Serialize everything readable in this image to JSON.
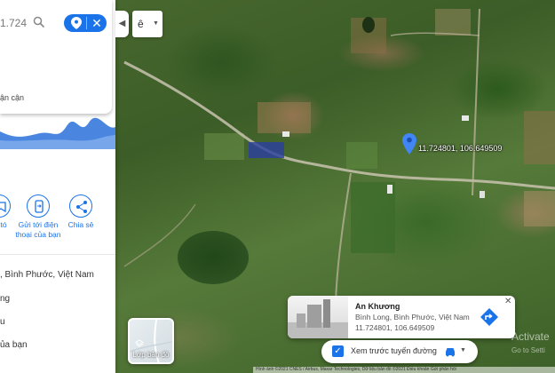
{
  "search": {
    "value": "1.72480'"
  },
  "panel": {
    "nearby_text": "ận cận",
    "actions": [
      {
        "label": "tó",
        "icon": "save-icon"
      },
      {
        "label": "Gửi tới điện thoại của bạn",
        "icon": "send-to-phone-icon"
      },
      {
        "label": "Chia sẻ",
        "icon": "share-icon"
      }
    ],
    "info_rows": [
      {
        "text": ", Bình Phước, Việt Nam",
        "icon": "location-icon"
      },
      {
        "text": "ng",
        "icon": "label-icon"
      },
      {
        "text": "u",
        "icon": "save-icon"
      },
      {
        "text": "ủa bạn",
        "icon": "phone-icon"
      }
    ]
  },
  "layer_control": {
    "glyph": "ê"
  },
  "layers_button": {
    "label": "Lớp bản đồ"
  },
  "marker": {
    "coordinates": "11.724801, 106.649509"
  },
  "place_card": {
    "title": "An Khương",
    "address": "Bình Long, Bình Phước, Việt Nam",
    "coordinates": "11.724801, 106.649509"
  },
  "route_preview": {
    "label": "Xem trước tuyến đường",
    "checked": true
  },
  "watermark": {
    "title": "Activate",
    "subtitle": "Go to Setti"
  },
  "attribution": {
    "text": "Hình ảnh ©2021 CNES / Airbus, Maxar Technologies, Dữ liệu bản đồ ©2021   Điều khoản   Gửi phản hồi"
  },
  "colors": {
    "accent": "#1a73e8",
    "panel_bg": "#ffffff"
  }
}
